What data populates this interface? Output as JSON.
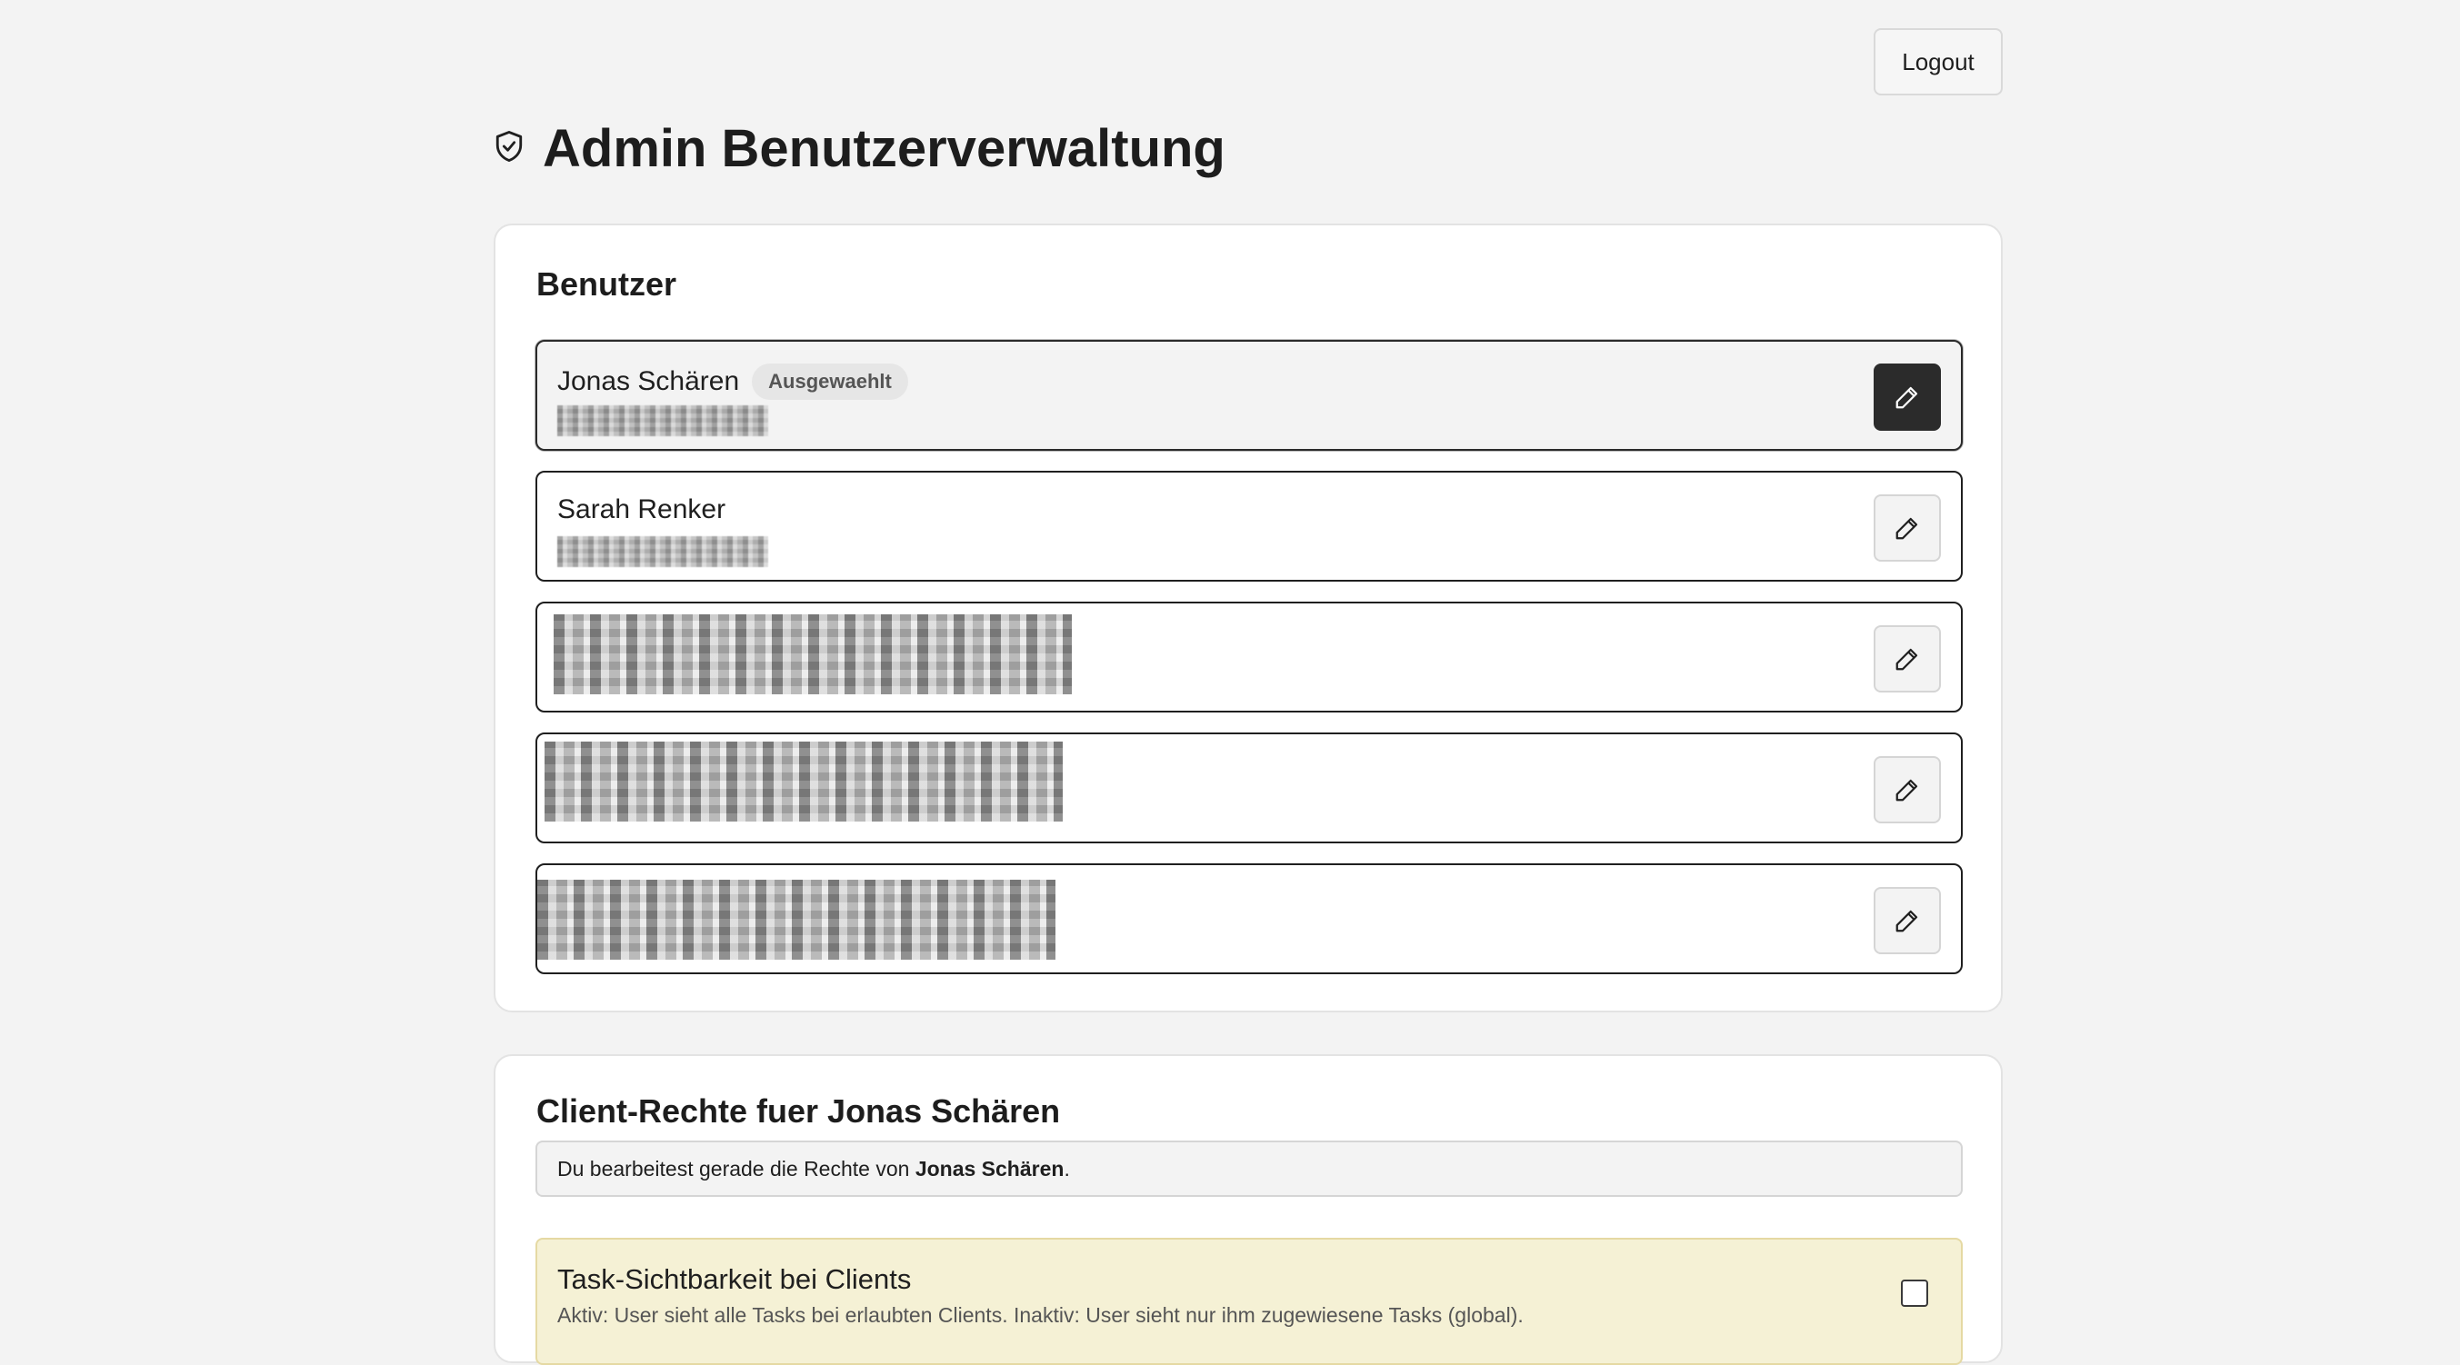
{
  "header": {
    "logout_label": "Logout",
    "title": "Admin Benutzerverwaltung",
    "title_icon": "shield-check-icon"
  },
  "users_card": {
    "heading": "Benutzer",
    "users": [
      {
        "name": "Jonas Schären",
        "badge": "Ausgewaehlt",
        "selected": true
      },
      {
        "name": "Sarah Renker",
        "badge": "",
        "selected": false
      }
    ],
    "edit_icon": "pencil-icon"
  },
  "rights_card": {
    "heading": "Client-Rechte fuer Jonas Schären",
    "info_prefix": "Du bearbeitest gerade die Rechte von ",
    "info_name": "Jonas Schären",
    "info_suffix": ".",
    "visibility_title": "Task-Sichtbarkeit bei Clients",
    "visibility_desc": "Aktiv: User sieht alle Tasks bei erlaubten Clients. Inaktiv: User sieht nur ihm zugewiesene Tasks (global).",
    "visibility_checked": false
  }
}
